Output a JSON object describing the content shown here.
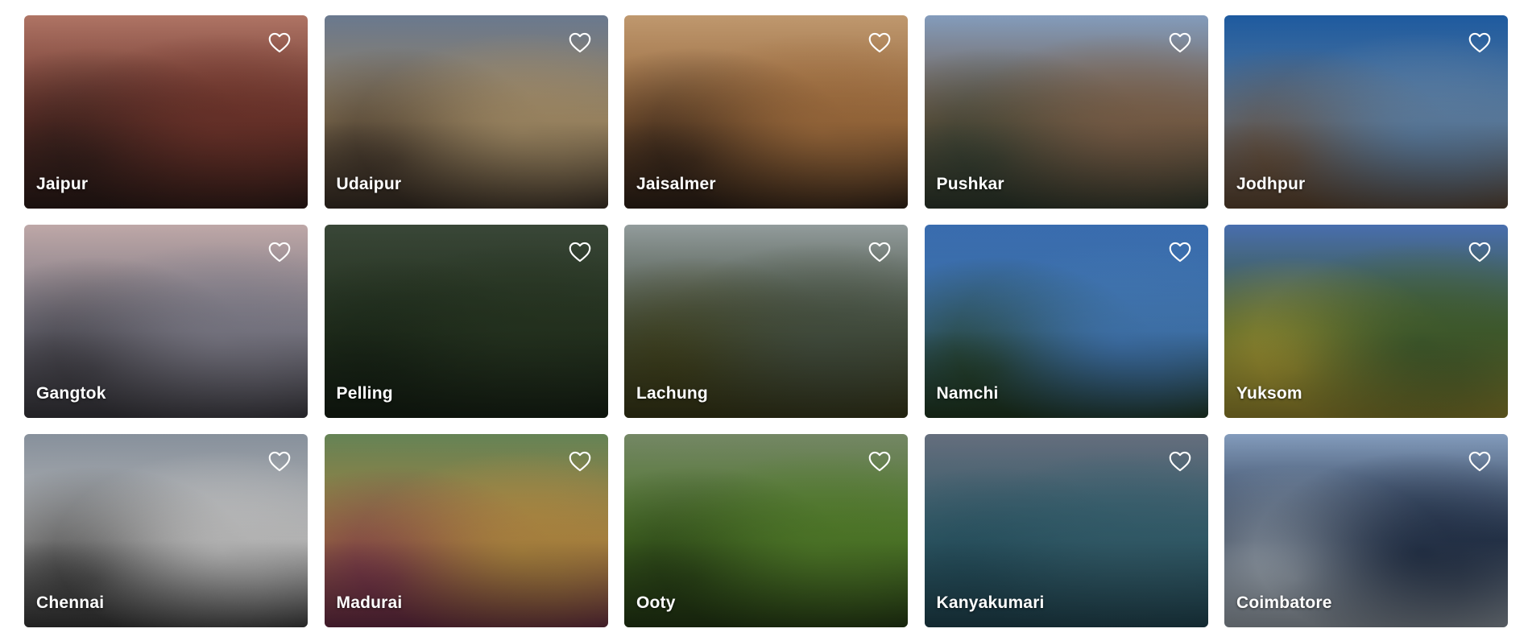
{
  "destinations": [
    {
      "name": "Jaipur",
      "scene": "pink-palace",
      "colors": [
        "#b87a6a",
        "#7a3a30",
        "#3a2420"
      ]
    },
    {
      "name": "Udaipur",
      "scene": "lake-palace",
      "colors": [
        "#6f7f96",
        "#b69c72",
        "#4a3c30"
      ]
    },
    {
      "name": "Jaisalmer",
      "scene": "desert-camels",
      "colors": [
        "#c9a074",
        "#b07844",
        "#3c2a1e"
      ]
    },
    {
      "name": "Pushkar",
      "scene": "lake-town",
      "colors": [
        "#8aa4c6",
        "#8a6c52",
        "#3c4a3a"
      ]
    },
    {
      "name": "Jodhpur",
      "scene": "fort-blue-sky",
      "colors": [
        "#1f5fa8",
        "#6a90b8",
        "#7a5a3e"
      ]
    },
    {
      "name": "Gangtok",
      "scene": "misty-hills",
      "colors": [
        "#c8b0b0",
        "#8c8a98",
        "#4c4a52"
      ]
    },
    {
      "name": "Pelling",
      "scene": "green-valley",
      "colors": [
        "#3c4a3a",
        "#2a3a24",
        "#1c2a1a"
      ]
    },
    {
      "name": "Lachung",
      "scene": "cloudy-mountains",
      "colors": [
        "#9aa4a4",
        "#4e5a48",
        "#4a4a1e"
      ]
    },
    {
      "name": "Namchi",
      "scene": "temple-gopuram",
      "colors": [
        "#3c72b8",
        "#4a86c8",
        "#2a4a2a"
      ]
    },
    {
      "name": "Yuksom",
      "scene": "monastery-garden",
      "colors": [
        "#4c74b8",
        "#4a6a34",
        "#c8b43c"
      ]
    },
    {
      "name": "Chennai",
      "scene": "white-building",
      "colors": [
        "#8e98a4",
        "#d8d8d8",
        "#4a4a4a"
      ]
    },
    {
      "name": "Madurai",
      "scene": "temple-sculptures",
      "colors": [
        "#6a8a5a",
        "#c89a4a",
        "#8a3a5a"
      ]
    },
    {
      "name": "Ooty",
      "scene": "tea-gardens",
      "colors": [
        "#7a8e6a",
        "#5a8a2e",
        "#2e4a1a"
      ]
    },
    {
      "name": "Kanyakumari",
      "scene": "island-memorial",
      "colors": [
        "#6a7484",
        "#3a6a7a",
        "#2a5a6a"
      ]
    },
    {
      "name": "Coimbatore",
      "scene": "statue-sky",
      "colors": [
        "#8aa4c6",
        "#2a3a54",
        "#c8d4e0"
      ]
    }
  ],
  "favorite_icon": "heart-outline-icon"
}
